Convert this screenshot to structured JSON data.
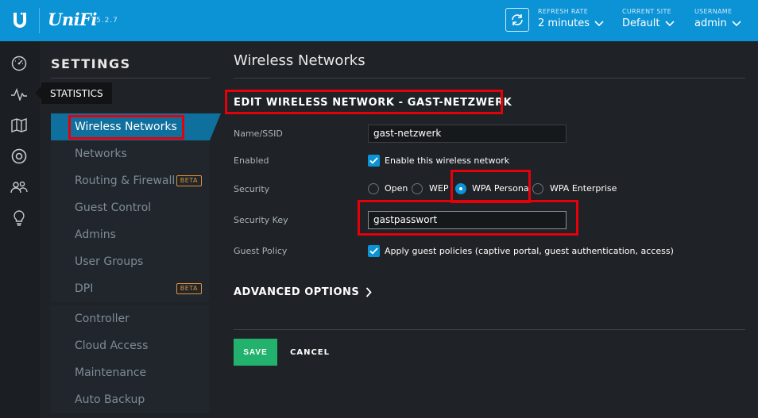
{
  "header": {
    "brand": "UniFi",
    "version": "5.2.7",
    "refresh_rate": {
      "label": "REFRESH RATE",
      "value": "2 minutes"
    },
    "current_site": {
      "label": "CURRENT SITE",
      "value": "Default"
    },
    "username": {
      "label": "USERNAME",
      "value": "admin"
    }
  },
  "iconbar": {
    "items": [
      "dashboard-icon",
      "statistics-icon",
      "map-icon",
      "devices-icon",
      "clients-icon",
      "insights-icon"
    ],
    "tooltip": "STATISTICS"
  },
  "sidebar": {
    "title": "SETTINGS",
    "items": [
      {
        "label": "Wireless Networks",
        "active": true
      },
      {
        "label": "Networks"
      },
      {
        "label": "Routing & Firewall",
        "badge": "BETA"
      },
      {
        "label": "Guest Control"
      },
      {
        "label": "Admins"
      },
      {
        "label": "User Groups"
      },
      {
        "label": "DPI",
        "badge": "BETA"
      },
      {
        "label": "Controller"
      },
      {
        "label": "Cloud Access"
      },
      {
        "label": "Maintenance"
      },
      {
        "label": "Auto Backup"
      }
    ]
  },
  "main": {
    "title": "Wireless Networks",
    "section_title": "EDIT WIRELESS NETWORK - GAST-NETZWERK",
    "fields": {
      "ssid": {
        "label": "Name/SSID",
        "value": "gast-netzwerk"
      },
      "enabled": {
        "label": "Enabled",
        "checkbox_label": "Enable this wireless network",
        "checked": true
      },
      "security": {
        "label": "Security",
        "options": [
          "Open",
          "WEP",
          "WPA Personal",
          "WPA Enterprise"
        ],
        "selected": "WPA Personal"
      },
      "security_key": {
        "label": "Security Key",
        "value": "gastpasswort"
      },
      "guest_policy": {
        "label": "Guest Policy",
        "checkbox_label": "Apply guest policies (captive portal, guest authentication, access)",
        "checked": true
      }
    },
    "advanced_options": "ADVANCED OPTIONS",
    "save_label": "SAVE",
    "cancel_label": "CANCEL"
  },
  "colors": {
    "topbar": "#0b93d6",
    "accent": "#0b93d6",
    "active_nav": "#0f6f9d",
    "save": "#23b26d",
    "beta": "#e0913a",
    "highlight": "#e6000a"
  }
}
